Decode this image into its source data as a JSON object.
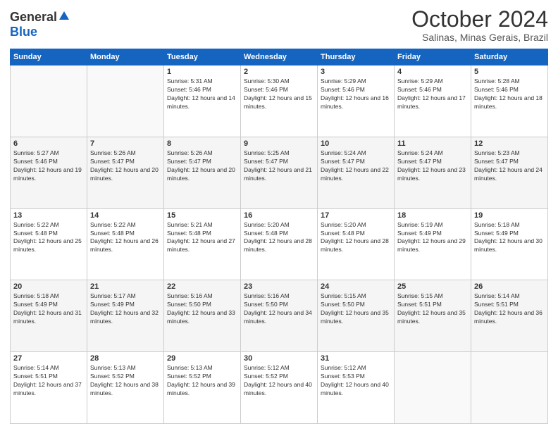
{
  "header": {
    "logo_general": "General",
    "logo_blue": "Blue",
    "month": "October 2024",
    "location": "Salinas, Minas Gerais, Brazil"
  },
  "days_of_week": [
    "Sunday",
    "Monday",
    "Tuesday",
    "Wednesday",
    "Thursday",
    "Friday",
    "Saturday"
  ],
  "weeks": [
    [
      {
        "day": "",
        "sunrise": "",
        "sunset": "",
        "daylight": ""
      },
      {
        "day": "",
        "sunrise": "",
        "sunset": "",
        "daylight": ""
      },
      {
        "day": "1",
        "sunrise": "Sunrise: 5:31 AM",
        "sunset": "Sunset: 5:46 PM",
        "daylight": "Daylight: 12 hours and 14 minutes."
      },
      {
        "day": "2",
        "sunrise": "Sunrise: 5:30 AM",
        "sunset": "Sunset: 5:46 PM",
        "daylight": "Daylight: 12 hours and 15 minutes."
      },
      {
        "day": "3",
        "sunrise": "Sunrise: 5:29 AM",
        "sunset": "Sunset: 5:46 PM",
        "daylight": "Daylight: 12 hours and 16 minutes."
      },
      {
        "day": "4",
        "sunrise": "Sunrise: 5:29 AM",
        "sunset": "Sunset: 5:46 PM",
        "daylight": "Daylight: 12 hours and 17 minutes."
      },
      {
        "day": "5",
        "sunrise": "Sunrise: 5:28 AM",
        "sunset": "Sunset: 5:46 PM",
        "daylight": "Daylight: 12 hours and 18 minutes."
      }
    ],
    [
      {
        "day": "6",
        "sunrise": "Sunrise: 5:27 AM",
        "sunset": "Sunset: 5:46 PM",
        "daylight": "Daylight: 12 hours and 19 minutes."
      },
      {
        "day": "7",
        "sunrise": "Sunrise: 5:26 AM",
        "sunset": "Sunset: 5:47 PM",
        "daylight": "Daylight: 12 hours and 20 minutes."
      },
      {
        "day": "8",
        "sunrise": "Sunrise: 5:26 AM",
        "sunset": "Sunset: 5:47 PM",
        "daylight": "Daylight: 12 hours and 20 minutes."
      },
      {
        "day": "9",
        "sunrise": "Sunrise: 5:25 AM",
        "sunset": "Sunset: 5:47 PM",
        "daylight": "Daylight: 12 hours and 21 minutes."
      },
      {
        "day": "10",
        "sunrise": "Sunrise: 5:24 AM",
        "sunset": "Sunset: 5:47 PM",
        "daylight": "Daylight: 12 hours and 22 minutes."
      },
      {
        "day": "11",
        "sunrise": "Sunrise: 5:24 AM",
        "sunset": "Sunset: 5:47 PM",
        "daylight": "Daylight: 12 hours and 23 minutes."
      },
      {
        "day": "12",
        "sunrise": "Sunrise: 5:23 AM",
        "sunset": "Sunset: 5:47 PM",
        "daylight": "Daylight: 12 hours and 24 minutes."
      }
    ],
    [
      {
        "day": "13",
        "sunrise": "Sunrise: 5:22 AM",
        "sunset": "Sunset: 5:48 PM",
        "daylight": "Daylight: 12 hours and 25 minutes."
      },
      {
        "day": "14",
        "sunrise": "Sunrise: 5:22 AM",
        "sunset": "Sunset: 5:48 PM",
        "daylight": "Daylight: 12 hours and 26 minutes."
      },
      {
        "day": "15",
        "sunrise": "Sunrise: 5:21 AM",
        "sunset": "Sunset: 5:48 PM",
        "daylight": "Daylight: 12 hours and 27 minutes."
      },
      {
        "day": "16",
        "sunrise": "Sunrise: 5:20 AM",
        "sunset": "Sunset: 5:48 PM",
        "daylight": "Daylight: 12 hours and 28 minutes."
      },
      {
        "day": "17",
        "sunrise": "Sunrise: 5:20 AM",
        "sunset": "Sunset: 5:48 PM",
        "daylight": "Daylight: 12 hours and 28 minutes."
      },
      {
        "day": "18",
        "sunrise": "Sunrise: 5:19 AM",
        "sunset": "Sunset: 5:49 PM",
        "daylight": "Daylight: 12 hours and 29 minutes."
      },
      {
        "day": "19",
        "sunrise": "Sunrise: 5:18 AM",
        "sunset": "Sunset: 5:49 PM",
        "daylight": "Daylight: 12 hours and 30 minutes."
      }
    ],
    [
      {
        "day": "20",
        "sunrise": "Sunrise: 5:18 AM",
        "sunset": "Sunset: 5:49 PM",
        "daylight": "Daylight: 12 hours and 31 minutes."
      },
      {
        "day": "21",
        "sunrise": "Sunrise: 5:17 AM",
        "sunset": "Sunset: 5:49 PM",
        "daylight": "Daylight: 12 hours and 32 minutes."
      },
      {
        "day": "22",
        "sunrise": "Sunrise: 5:16 AM",
        "sunset": "Sunset: 5:50 PM",
        "daylight": "Daylight: 12 hours and 33 minutes."
      },
      {
        "day": "23",
        "sunrise": "Sunrise: 5:16 AM",
        "sunset": "Sunset: 5:50 PM",
        "daylight": "Daylight: 12 hours and 34 minutes."
      },
      {
        "day": "24",
        "sunrise": "Sunrise: 5:15 AM",
        "sunset": "Sunset: 5:50 PM",
        "daylight": "Daylight: 12 hours and 35 minutes."
      },
      {
        "day": "25",
        "sunrise": "Sunrise: 5:15 AM",
        "sunset": "Sunset: 5:51 PM",
        "daylight": "Daylight: 12 hours and 35 minutes."
      },
      {
        "day": "26",
        "sunrise": "Sunrise: 5:14 AM",
        "sunset": "Sunset: 5:51 PM",
        "daylight": "Daylight: 12 hours and 36 minutes."
      }
    ],
    [
      {
        "day": "27",
        "sunrise": "Sunrise: 5:14 AM",
        "sunset": "Sunset: 5:51 PM",
        "daylight": "Daylight: 12 hours and 37 minutes."
      },
      {
        "day": "28",
        "sunrise": "Sunrise: 5:13 AM",
        "sunset": "Sunset: 5:52 PM",
        "daylight": "Daylight: 12 hours and 38 minutes."
      },
      {
        "day": "29",
        "sunrise": "Sunrise: 5:13 AM",
        "sunset": "Sunset: 5:52 PM",
        "daylight": "Daylight: 12 hours and 39 minutes."
      },
      {
        "day": "30",
        "sunrise": "Sunrise: 5:12 AM",
        "sunset": "Sunset: 5:52 PM",
        "daylight": "Daylight: 12 hours and 40 minutes."
      },
      {
        "day": "31",
        "sunrise": "Sunrise: 5:12 AM",
        "sunset": "Sunset: 5:53 PM",
        "daylight": "Daylight: 12 hours and 40 minutes."
      },
      {
        "day": "",
        "sunrise": "",
        "sunset": "",
        "daylight": ""
      },
      {
        "day": "",
        "sunrise": "",
        "sunset": "",
        "daylight": ""
      }
    ]
  ]
}
